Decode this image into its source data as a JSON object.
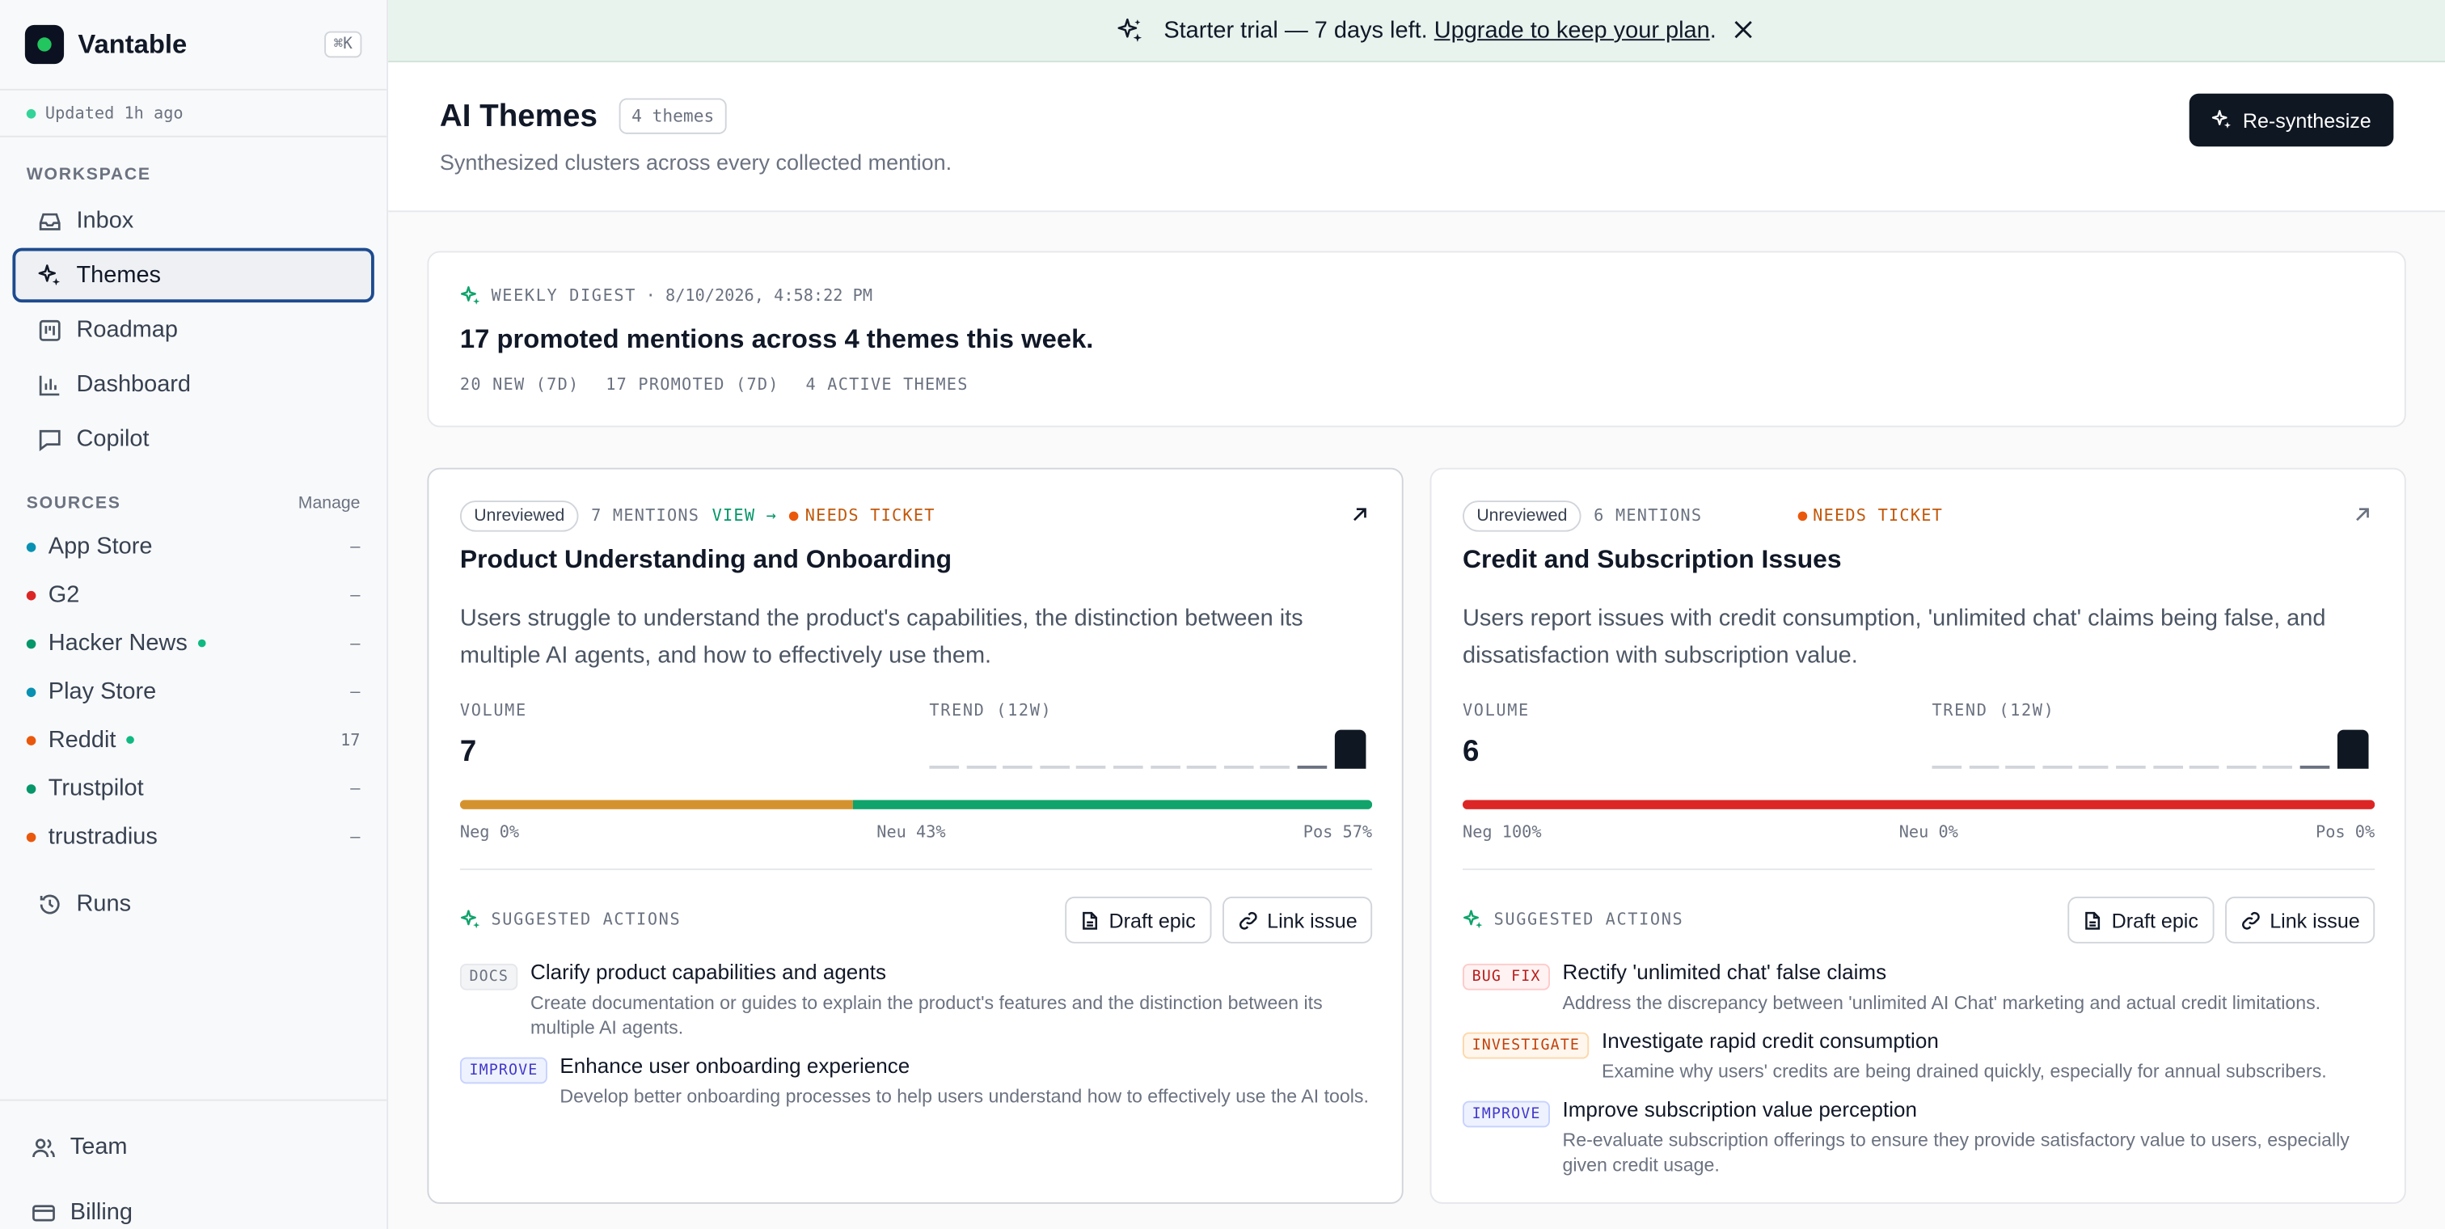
{
  "app": {
    "name": "Vantable",
    "shortcut": "⌘K",
    "updated": "Updated 1h ago"
  },
  "sidebar": {
    "workspace_label": "WORKSPACE",
    "nav": [
      {
        "label": "Inbox",
        "icon": "inbox-icon"
      },
      {
        "label": "Themes",
        "icon": "sparkles-icon",
        "active": true
      },
      {
        "label": "Roadmap",
        "icon": "kanban-icon"
      },
      {
        "label": "Dashboard",
        "icon": "bar-chart-icon"
      },
      {
        "label": "Copilot",
        "icon": "chat-icon"
      }
    ],
    "sources_label": "SOURCES",
    "manage_label": "Manage",
    "sources": [
      {
        "label": "App Store",
        "color": "#0891b2",
        "count": "–",
        "live": false
      },
      {
        "label": "G2",
        "color": "#dc2626",
        "count": "–",
        "live": false
      },
      {
        "label": "Hacker News",
        "color": "#059669",
        "count": "–",
        "live": true
      },
      {
        "label": "Play Store",
        "color": "#0891b2",
        "count": "–",
        "live": false
      },
      {
        "label": "Reddit",
        "color": "#ea580c",
        "count": "17",
        "live": true
      },
      {
        "label": "Trustpilot",
        "color": "#059669",
        "count": "–",
        "live": false
      },
      {
        "label": "trustradius",
        "color": "#ea580c",
        "count": "–",
        "live": false
      }
    ],
    "runs_label": "Runs",
    "team_label": "Team",
    "billing_label": "Billing"
  },
  "banner": {
    "text": "Starter trial — 7 days left. ",
    "link": "Upgrade to keep your plan",
    "suffix": "."
  },
  "header": {
    "title": "AI Themes",
    "count": "4 themes",
    "subtitle": "Synthesized clusters across every collected mention.",
    "button": "Re-synthesize"
  },
  "digest": {
    "label": "WEEKLY DIGEST",
    "timestamp": "· 8/10/2026, 4:58:22 PM",
    "title": "17 promoted mentions across 4 themes this week.",
    "stats": [
      "20 NEW (7D)",
      "17 PROMOTED (7D)",
      "4 ACTIVE THEMES"
    ]
  },
  "themes": [
    {
      "status": "Unreviewed",
      "mentions": "7 MENTIONS",
      "view": "VIEW →",
      "flag": "NEEDS TICKET",
      "title": "Product Understanding and Onboarding",
      "description": "Users struggle to understand the product's capabilities, the distinction between its multiple AI agents, and how to effectively use them.",
      "volume_label": "VOLUME",
      "volume": "7",
      "trend_label": "TREND (12W)",
      "trend": [
        0,
        0,
        0,
        0,
        0,
        0,
        0,
        0,
        0,
        0,
        1,
        7
      ],
      "sentiment": {
        "neg": 0,
        "neu": 43,
        "pos": 57
      },
      "neg_label": "Neg 0%",
      "neu_label": "Neu 43%",
      "pos_label": "Pos 57%",
      "actions_label": "SUGGESTED ACTIONS",
      "draft_label": "Draft epic",
      "link_label": "Link issue",
      "actions": [
        {
          "tag": "DOCS",
          "kind": "docs",
          "title": "Clarify product capabilities and agents",
          "desc": "Create documentation or guides to explain the product's features and the distinction between its multiple AI agents."
        },
        {
          "tag": "IMPROVE",
          "kind": "improve",
          "title": "Enhance user onboarding experience",
          "desc": "Develop better onboarding processes to help users understand how to effectively use the AI tools."
        }
      ]
    },
    {
      "status": "Unreviewed",
      "mentions": "6 MENTIONS",
      "view": "",
      "flag": "NEEDS TICKET",
      "title": "Credit and Subscription Issues",
      "description": "Users report issues with credit consumption, 'unlimited chat' claims being false, and dissatisfaction with subscription value.",
      "volume_label": "VOLUME",
      "volume": "6",
      "trend_label": "TREND (12W)",
      "trend": [
        0,
        0,
        0,
        0,
        0,
        0,
        0,
        0,
        0,
        0,
        1,
        6
      ],
      "sentiment": {
        "neg": 100,
        "neu": 0,
        "pos": 0
      },
      "neg_label": "Neg 100%",
      "neu_label": "Neu 0%",
      "pos_label": "Pos 0%",
      "actions_label": "SUGGESTED ACTIONS",
      "draft_label": "Draft epic",
      "link_label": "Link issue",
      "actions": [
        {
          "tag": "BUG FIX",
          "kind": "bug",
          "title": "Rectify 'unlimited chat' false claims",
          "desc": "Address the discrepancy between 'unlimited AI Chat' marketing and actual credit limitations."
        },
        {
          "tag": "INVESTIGATE",
          "kind": "investigate",
          "title": "Investigate rapid credit consumption",
          "desc": "Examine why users' credits are being drained quickly, especially for annual subscribers."
        },
        {
          "tag": "IMPROVE",
          "kind": "improve",
          "title": "Improve subscription value perception",
          "desc": "Re-evaluate subscription offerings to ensure they provide satisfactory value to users, especially given credit usage."
        }
      ]
    }
  ],
  "colors": {
    "neg": "#dc2626",
    "neu": "#d4922f",
    "pos": "#10a36b",
    "brand": "#0f1722"
  }
}
